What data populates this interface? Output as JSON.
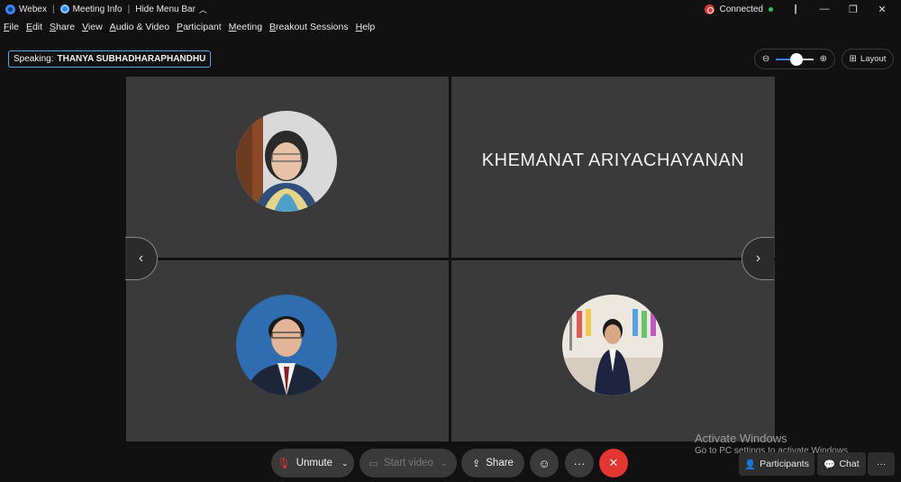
{
  "titlebar": {
    "app_name": "Webex",
    "meeting_info": "Meeting Info",
    "hide_menu": "Hide Menu Bar",
    "status": "Connected"
  },
  "menu": [
    "File",
    "Edit",
    "Share",
    "View",
    "Audio & Video",
    "Participant",
    "Meeting",
    "Breakout Sessions",
    "Help"
  ],
  "speaking": {
    "label": "Speaking:",
    "name": "THANYA SUBHADHARAPHANDHU"
  },
  "toolbar": {
    "layout_label": "Layout",
    "zoom_level": 0.55
  },
  "tiles": [
    {
      "type": "avatar"
    },
    {
      "type": "name",
      "name": "KHEMANAT ARIYACHAYANAN"
    },
    {
      "type": "avatar"
    },
    {
      "type": "avatar"
    }
  ],
  "controls": {
    "unmute": "Unmute",
    "start_video": "Start video",
    "share": "Share",
    "participants": "Participants",
    "chat": "Chat"
  },
  "watermark": {
    "line1": "Activate Windows",
    "line2": "Go to PC settings to activate Windows."
  },
  "colors": {
    "end_call": "#e5352f",
    "accent": "#3b82f6",
    "connected": "#2ec05a"
  }
}
